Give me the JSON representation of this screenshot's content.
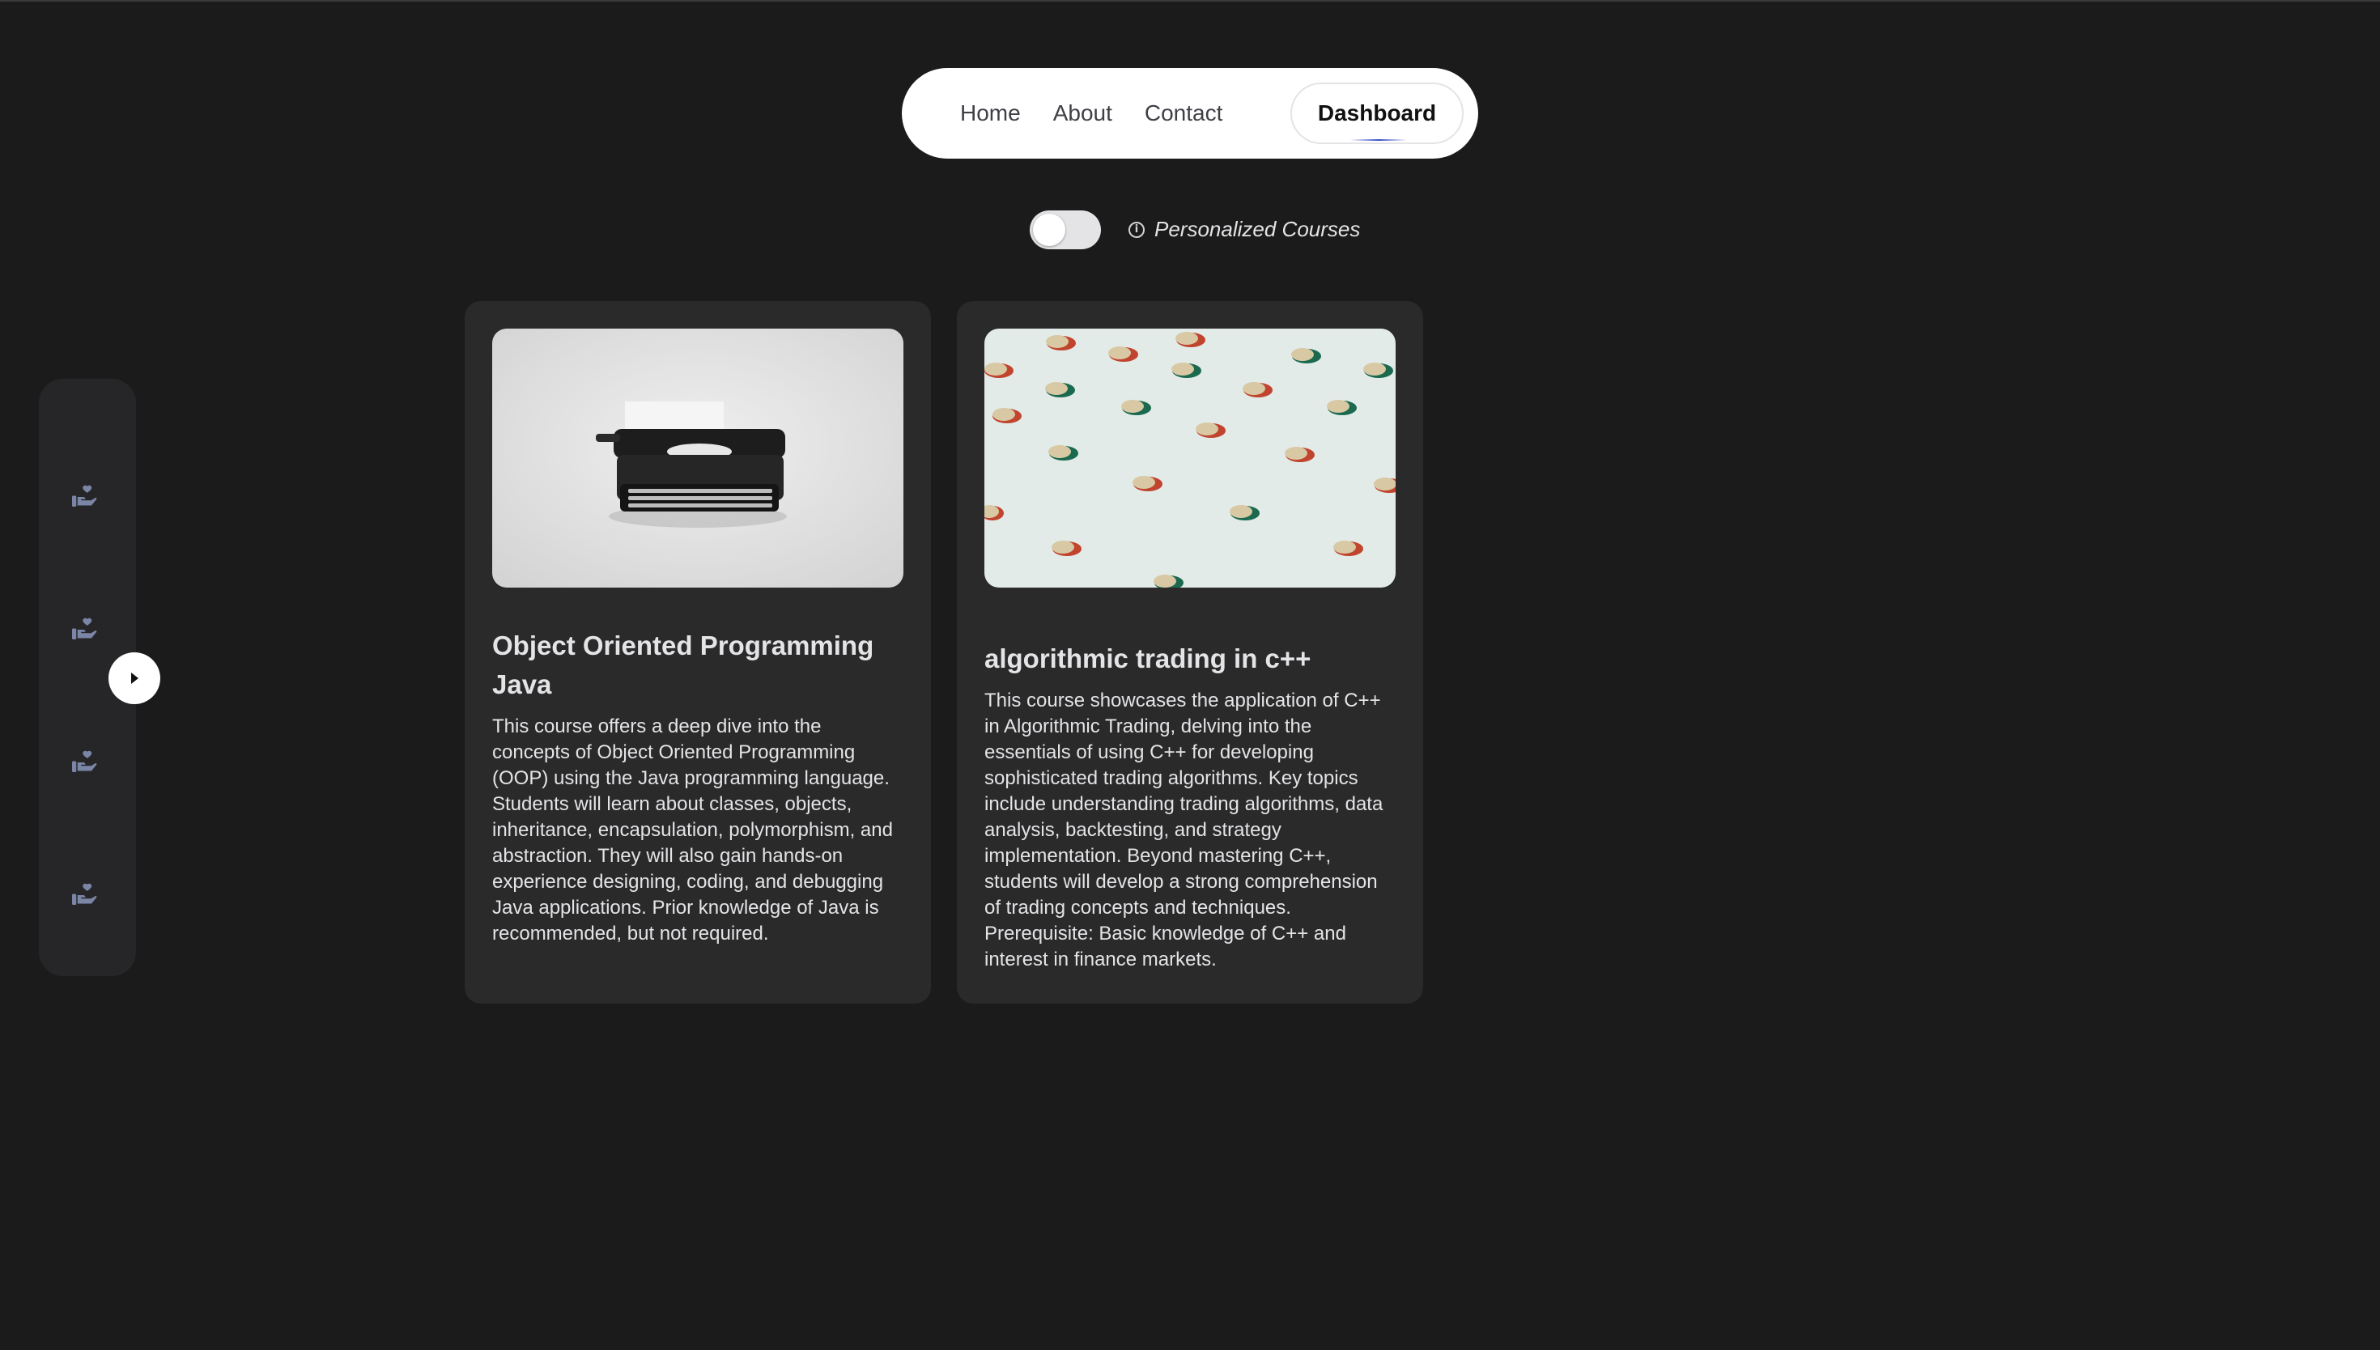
{
  "nav": {
    "links": [
      "Home",
      "About",
      "Contact"
    ],
    "dashboard_label": "Dashboard"
  },
  "toggle": {
    "label": "Personalized Courses",
    "checked": false
  },
  "sidebar": {
    "items": [
      {
        "icon": "hand-heart-icon"
      },
      {
        "icon": "hand-heart-icon"
      },
      {
        "icon": "hand-heart-icon"
      },
      {
        "icon": "hand-heart-icon"
      }
    ],
    "expand_icon": "play-triangle-icon"
  },
  "courses": [
    {
      "title": "Object Oriented Programming Java",
      "description": "This course offers a deep dive into the concepts of Object Oriented Programming (OOP) using the Java programming language. Students will learn about classes, objects, inheritance, encapsulation, polymorphism, and abstraction. They will also gain hands-on experience designing, coding, and debugging Java applications. Prior knowledge of Java is recommended, but not required.",
      "image": "typewriter-photo"
    },
    {
      "title": "algorithmic trading in c++",
      "description": "This course showcases the application of C++ in Algorithmic Trading, delving into the essentials of using C++ for developing sophisticated trading algorithms. Key topics include understanding trading algorithms, data analysis, backtesting, and strategy implementation. Beyond mastering C++, students will develop a strong comprehension of trading concepts and techniques. Prerequisite: Basic knowledge of C++ and interest in finance markets.",
      "image": "coins-pattern-photo"
    }
  ],
  "colors": {
    "background": "#1b1b1b",
    "card": "#2a2a2b",
    "sidebar": "#262629",
    "icon": "#7b86a6"
  }
}
